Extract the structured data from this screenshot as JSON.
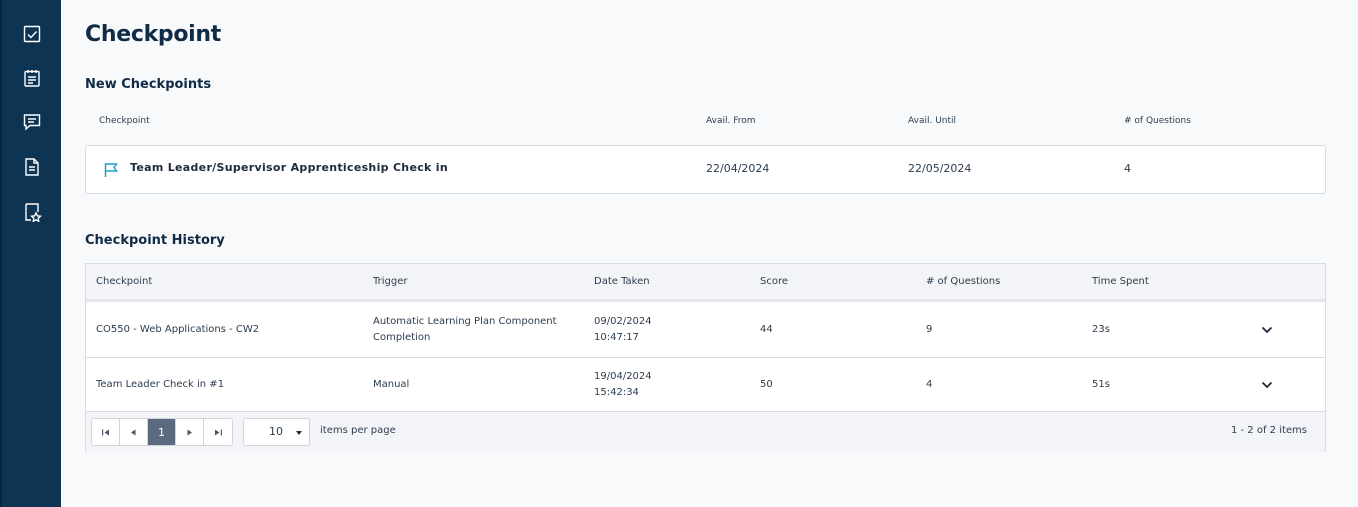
{
  "sidebar": {
    "items": [
      {
        "name": "checkbox-icon"
      },
      {
        "name": "clipboard-icon"
      },
      {
        "name": "chat-icon"
      },
      {
        "name": "document-icon"
      },
      {
        "name": "bookmark-star-icon"
      }
    ]
  },
  "page": {
    "title": "Checkpoint"
  },
  "new_checkpoints": {
    "title": "New Checkpoints",
    "headers": {
      "checkpoint": "Checkpoint",
      "avail_from": "Avail. From",
      "avail_until": "Avail. Until",
      "questions": "# of Questions"
    },
    "row": {
      "icon": "flag-icon",
      "name": "Team Leader/Supervisor Apprenticeship Check in",
      "avail_from": "22/04/2024",
      "avail_until": "22/05/2024",
      "questions": "4"
    }
  },
  "history": {
    "title": "Checkpoint History",
    "headers": {
      "checkpoint": "Checkpoint",
      "trigger": "Trigger",
      "date_taken": "Date Taken",
      "score": "Score",
      "questions": "# of Questions",
      "time_spent": "Time Spent"
    },
    "rows": [
      {
        "checkpoint": "CO550 - Web Applications - CW2",
        "trigger_line1": "Automatic Learning Plan Component",
        "trigger_line2": "Completion",
        "date": "09/02/2024",
        "time": "10:47:17",
        "score": "44",
        "questions": "9",
        "time_spent": "23s"
      },
      {
        "checkpoint": "Team Leader Check in #1",
        "trigger_line1": "Manual",
        "trigger_line2": "",
        "date": "19/04/2024",
        "time": "15:42:34",
        "score": "50",
        "questions": "4",
        "time_spent": "51s"
      }
    ],
    "pager": {
      "current_page": "1",
      "page_size": "10",
      "items_per_page_label": "items per page",
      "info": "1 - 2 of 2 items"
    }
  },
  "colors": {
    "sidebar": "#0d3553",
    "accent": "#1fa0c8",
    "active_page": "#5a6b80"
  }
}
